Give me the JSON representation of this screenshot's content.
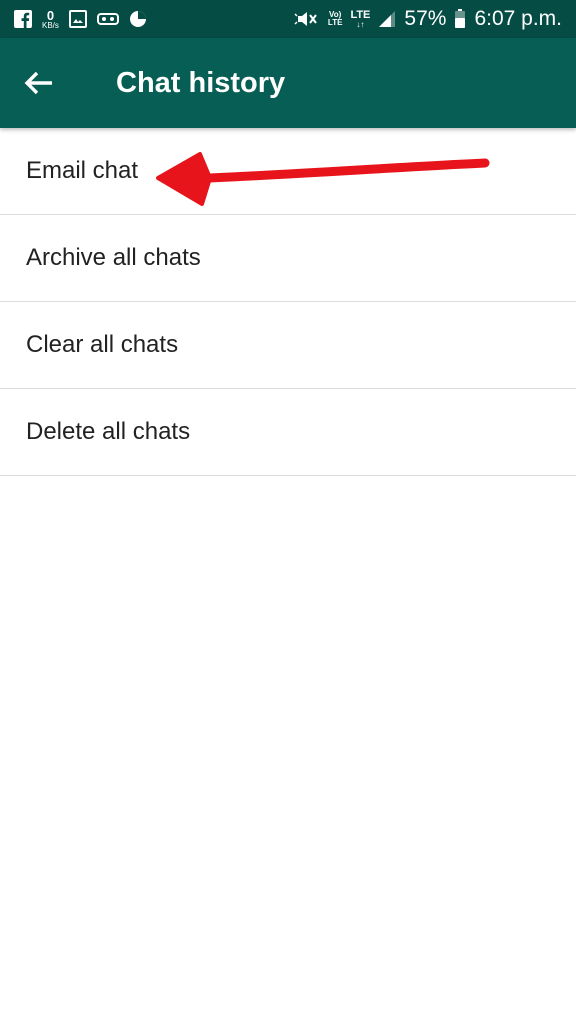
{
  "status_bar": {
    "data_rate_value": "0",
    "data_rate_unit": "KB/s",
    "network_volte": "Vo)",
    "network_volte_sub": "LTE",
    "network_lte": "LTE",
    "network_lte_sub": "↓↑",
    "battery_percent": "57%",
    "time": "6:07 p.m.",
    "icons": [
      "facebook-icon",
      "gallery-icon",
      "vr-icon",
      "pie-icon",
      "mute-icon",
      "signal-icon",
      "battery-icon"
    ],
    "colors": {
      "background": "#054d44",
      "text": "#ffffff"
    }
  },
  "app_bar": {
    "title": "Chat history",
    "back_icon": "arrow-left-icon",
    "color": "#075e54"
  },
  "menu": {
    "items": [
      {
        "label": "Email chat"
      },
      {
        "label": "Archive all chats"
      },
      {
        "label": "Clear all chats"
      },
      {
        "label": "Delete all chats"
      }
    ]
  },
  "annotation": {
    "type": "red-arrow",
    "points_to": "Email chat",
    "color": "#e8141b"
  }
}
